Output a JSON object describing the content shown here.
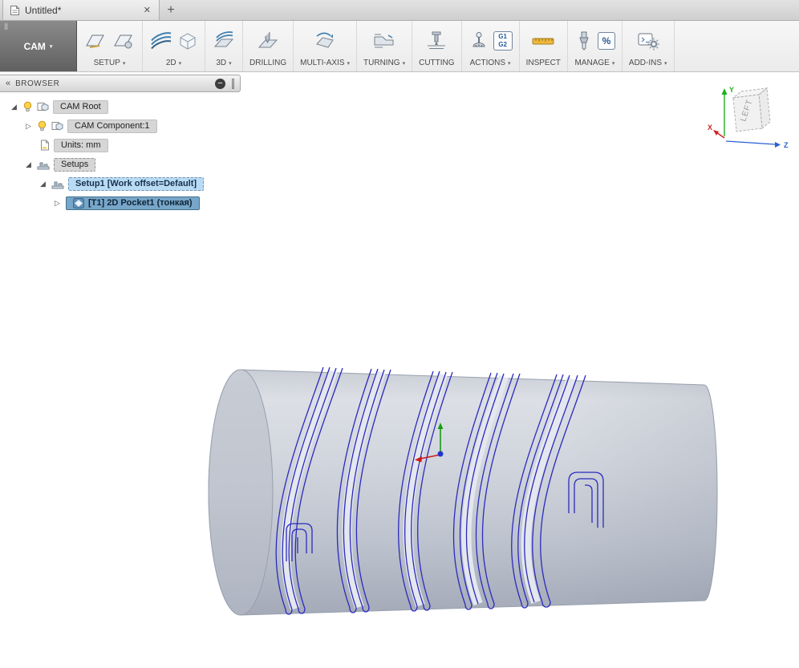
{
  "tab_bar": {
    "active_tab": {
      "title": "Untitled*",
      "close_glyph": "✕"
    },
    "new_tab_glyph": "+"
  },
  "ribbon": {
    "workspace_button": {
      "label": "CAM",
      "arrow": "▾"
    },
    "groups": [
      {
        "label": "SETUP"
      },
      {
        "label": "2D"
      },
      {
        "label": "3D"
      },
      {
        "label": "DRILLING"
      },
      {
        "label": "MULTI-AXIS"
      },
      {
        "label": "TURNING"
      },
      {
        "label": "CUTTING"
      },
      {
        "label": "ACTIONS"
      },
      {
        "label": "INSPECT"
      },
      {
        "label": "MANAGE"
      },
      {
        "label": "ADD-INS"
      }
    ],
    "badges": {
      "g1": "G1",
      "g2": "G2",
      "percent": "%"
    }
  },
  "browser": {
    "title": "BROWSER",
    "collapse_glyph": "«",
    "hide_glyph": "−",
    "tree": [
      {
        "label": "CAM Root"
      },
      {
        "label": "CAM Component:1"
      },
      {
        "label": "Units: mm"
      },
      {
        "label": "Setups"
      },
      {
        "label": "Setup1 [Work offset=Default]"
      },
      {
        "label": "[T1] 2D Pocket1 (тонкая)"
      }
    ]
  },
  "viewcube": {
    "face_label": "LEFT",
    "axis_x": "X",
    "axis_y": "Y",
    "axis_z": "Z"
  },
  "colors": {
    "toolpath_blue": "#2b2bbd",
    "selection_light": "#badbf4",
    "selection_strong": "#78a6c9"
  }
}
